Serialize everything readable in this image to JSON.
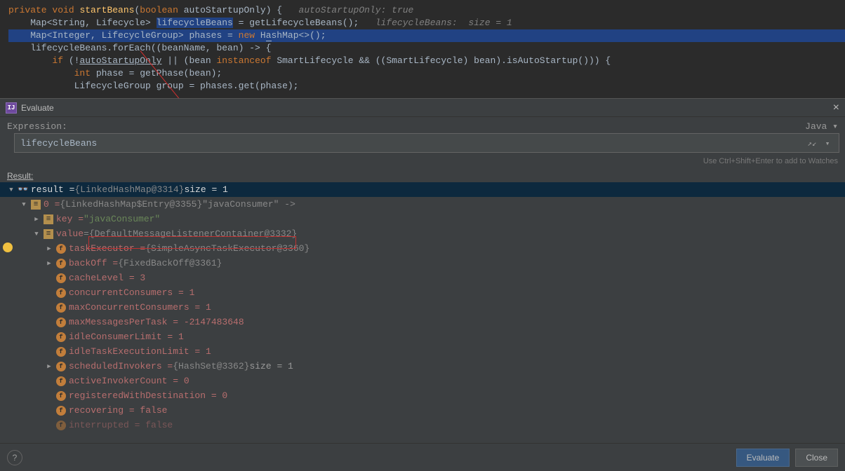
{
  "code": {
    "l1a": "private ",
    "l1b": "void ",
    "l1c": "startBeans",
    "l1d": "(",
    "l1e": "boolean ",
    "l1f": "autoStartupOnly) {   ",
    "l1g": "autoStartupOnly: true",
    "l2a": "    Map<String, Lifecycle> ",
    "l2b": "lifecycleBeans",
    "l2c": " = getLifecycleBeans();   ",
    "l2d": "lifecycleBeans:  size = 1",
    "l3": "    Map<Integer, LifecycleGroup> phases = ",
    "l3b": "new ",
    "l3c": "H",
    "l3d": "a",
    "l3e": "shMap<>();",
    "l4": "    lifecycleBeans.forEach((beanName, bean) -> {",
    "l5a": "        if ",
    "l5b": "(!",
    "l5c": "autoStartupOnly",
    "l5d": " || (bean ",
    "l5e": "instanceof ",
    "l5f": "SmartLifecycle && ((SmartLifecycle) bean).isAutoStartup())) {",
    "l6a": "            int ",
    "l6b": "phase = getPhase(bean);",
    "l7": "            LifecycleGroup group = phases.get(phase);"
  },
  "dialog": {
    "title": "Evaluate",
    "exprLabel": "Expression:",
    "lang": "Java ▾",
    "exprValue": "lifecycleBeans",
    "hint": "Use Ctrl+Shift+Enter to add to Watches",
    "resultLabel": "Result:",
    "evaluate": "Evaluate",
    "close": "Close"
  },
  "tree": {
    "r0a": "result = ",
    "r0b": "{LinkedHashMap@3314}",
    "r0c": "  size = 1",
    "r1a": "0 = ",
    "r1b": "{LinkedHashMap$Entry@3355}",
    "r1c": " \"javaConsumer\" ->",
    "r2a": "key = ",
    "r2b": "\"javaConsumer\"",
    "r3a": "value",
    "r3b": " = ",
    "r3c": "{DefaultMessageListenerContainer@3332}",
    "r4a": "taskExecutor = ",
    "r4b": "{SimpleAsyncTaskExecutor@3360}",
    "r5a": "backOff = ",
    "r5b": "{FixedBackOff@3361}",
    "r6": "cacheLevel = 3",
    "r7": "concurrentConsumers = 1",
    "r8": "maxConcurrentConsumers = 1",
    "r9": "maxMessagesPerTask = -2147483648",
    "r10": "idleConsumerLimit = 1",
    "r11": "idleTaskExecutionLimit = 1",
    "r12a": "scheduledInvokers = ",
    "r12b": "{HashSet@3362}",
    "r12c": "  size = 1",
    "r13": "activeInvokerCount = 0",
    "r14": "registeredWithDestination = 0",
    "r15": "recovering = false",
    "r16": "interrupted = false"
  }
}
